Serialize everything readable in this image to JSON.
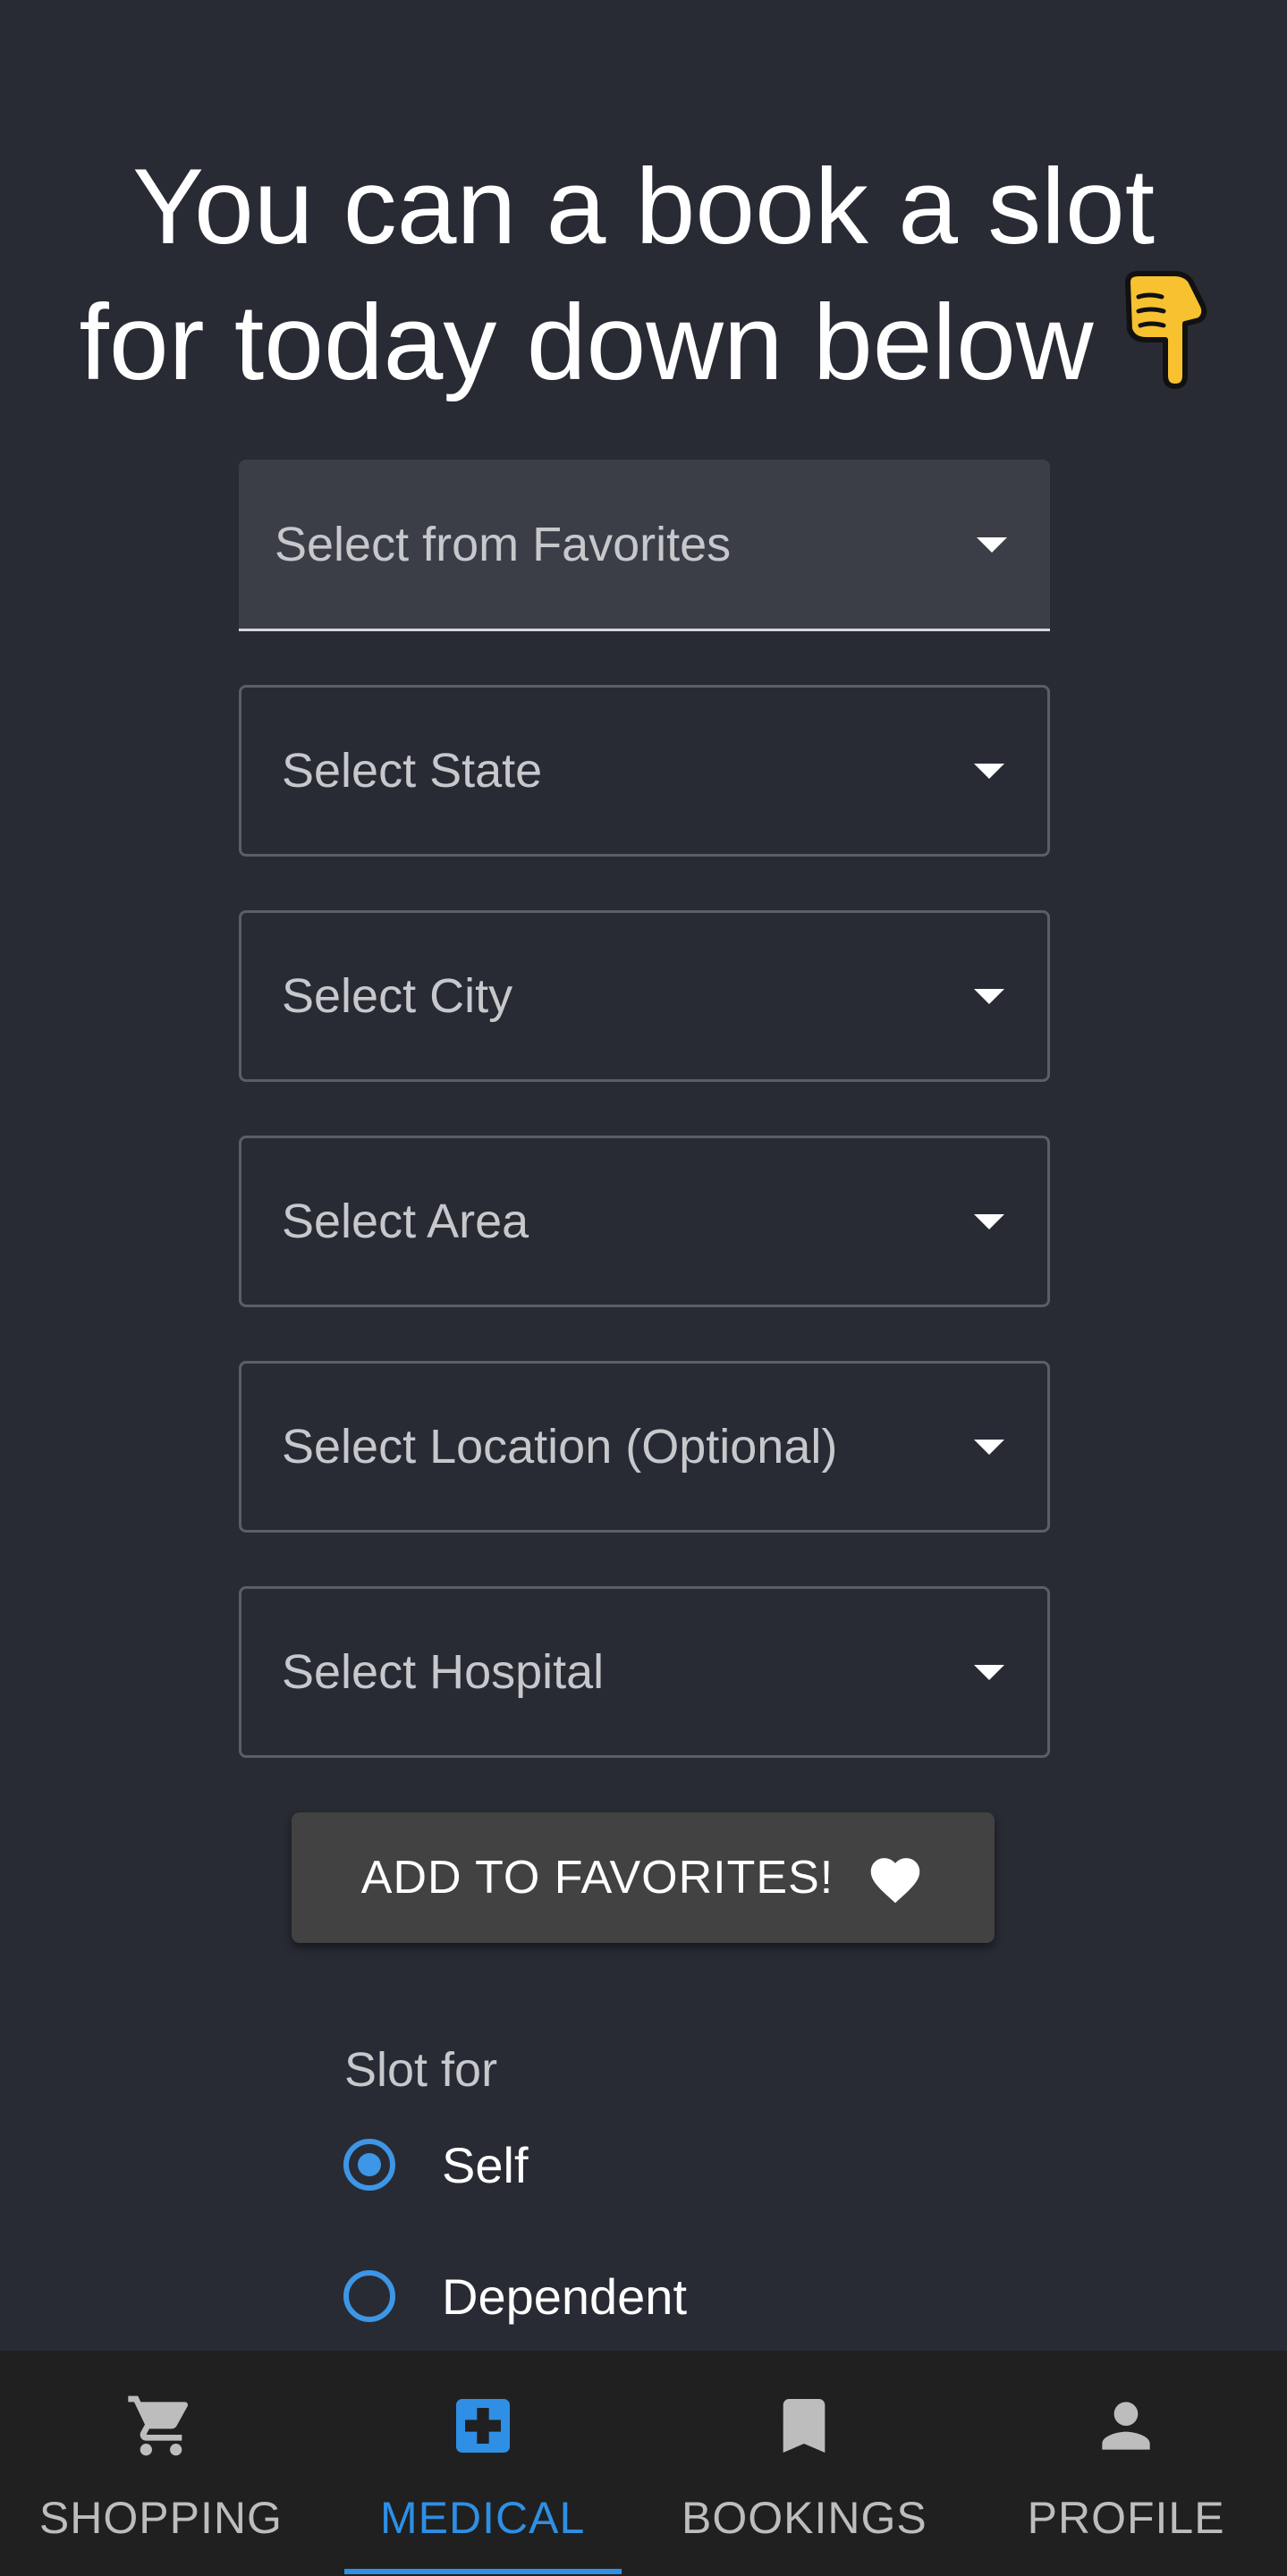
{
  "heading": {
    "line1": "You can a book a slot",
    "line2": "for today down below"
  },
  "dropdowns": [
    {
      "label": "Select from Favorites"
    },
    {
      "label": "Select State"
    },
    {
      "label": "Select City"
    },
    {
      "label": "Select Area"
    },
    {
      "label": "Select Location (Optional)"
    },
    {
      "label": "Select Hospital"
    }
  ],
  "favorites_button": {
    "label": "ADD TO FAVORITES!",
    "icon": "heart-icon"
  },
  "slot": {
    "label": "Slot for",
    "options": [
      {
        "label": "Self",
        "checked": true
      },
      {
        "label": "Dependent",
        "checked": false
      }
    ]
  },
  "bottom_nav": {
    "items": [
      {
        "label": "SHOPPING",
        "icon": "cart-icon",
        "active": false
      },
      {
        "label": "MEDICAL",
        "icon": "medical-icon",
        "active": true
      },
      {
        "label": "BOOKINGS",
        "icon": "bookmark-icon",
        "active": false
      },
      {
        "label": "PROFILE",
        "icon": "person-icon",
        "active": false
      }
    ]
  },
  "colors": {
    "background": "#282b34",
    "accent": "#2e8fe4",
    "nav_background": "#202020",
    "button_background": "#424243"
  }
}
